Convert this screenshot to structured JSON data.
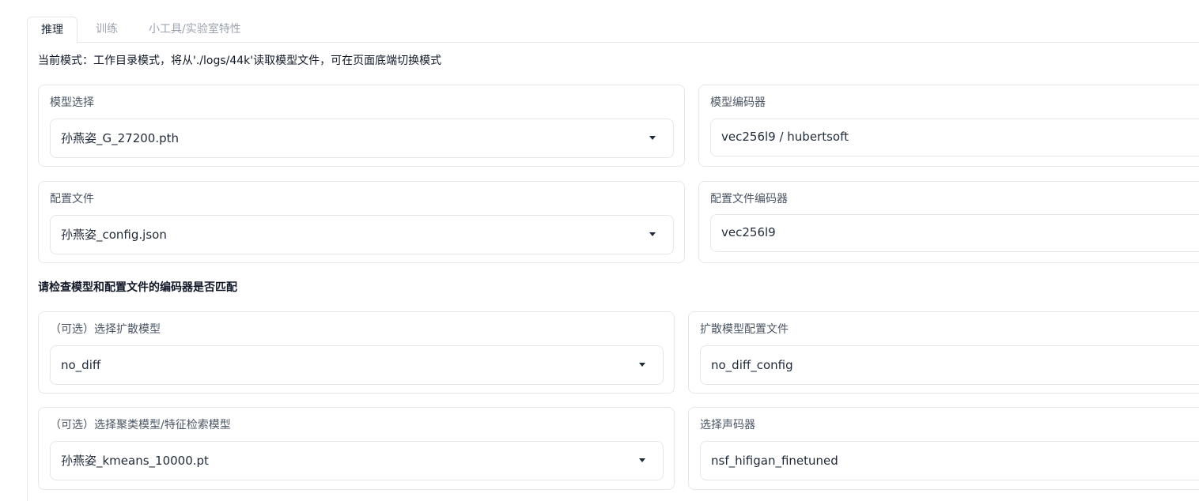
{
  "tabs": [
    {
      "label": "推理",
      "active": true
    },
    {
      "label": "训练",
      "active": false
    },
    {
      "label": "小工具/实验室特性",
      "active": false
    }
  ],
  "mode_text": "当前模式：工作目录模式，将从'./logs/44k'读取模型文件，可在页面底端切换模式",
  "model": {
    "label": "模型选择",
    "value": "孙燕姿_G_27200.pth"
  },
  "model_encoder": {
    "label": "模型编码器",
    "value": "vec256l9 / hubertsoft"
  },
  "config": {
    "label": "配置文件",
    "value": "孙燕姿_config.json"
  },
  "config_encoder": {
    "label": "配置文件编码器",
    "value": "vec256l9"
  },
  "check_title": "请检查模型和配置文件的编码器是否匹配",
  "diffusion": {
    "label": "（可选）选择扩散模型",
    "value": "no_diff"
  },
  "diffusion_config": {
    "label": "扩散模型配置文件",
    "value": "no_diff_config"
  },
  "cluster": {
    "label": "（可选）选择聚类模型/特征检索模型",
    "value": "孙燕姿_kmeans_10000.pt"
  },
  "vocoder": {
    "label": "选择声码器",
    "value": "nsf_hifigan_finetuned"
  },
  "icons": {
    "dropdown": "chevron-down-icon"
  }
}
